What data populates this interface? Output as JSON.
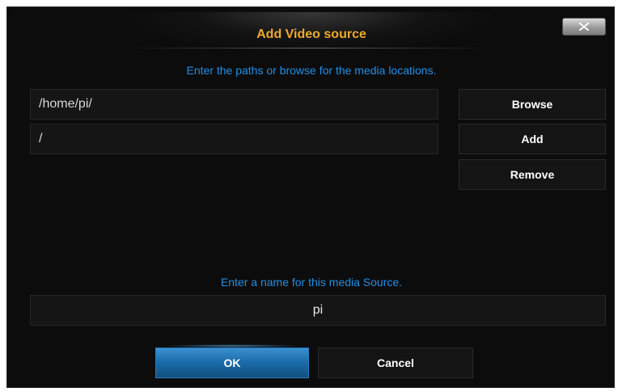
{
  "dialog": {
    "title": "Add Video source",
    "close_icon": "close-icon",
    "close_label": "X"
  },
  "paths": {
    "instruction": "Enter the paths or browse for the media locations.",
    "entries": [
      "/home/pi/",
      "/"
    ]
  },
  "actions": {
    "browse_label": "Browse",
    "add_label": "Add",
    "remove_label": "Remove"
  },
  "source_name": {
    "instruction": "Enter a name for this media Source.",
    "value": "pi"
  },
  "footer": {
    "ok_label": "OK",
    "cancel_label": "Cancel"
  },
  "colors": {
    "title": "#f0a929",
    "instruction": "#1e90e8",
    "background": "#0c0c0c",
    "ok_button": "#1a6aa8"
  }
}
